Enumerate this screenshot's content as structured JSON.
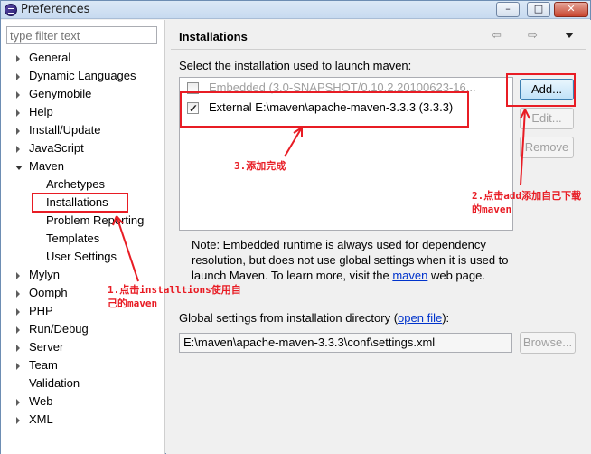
{
  "window": {
    "title": "Preferences",
    "min": "–",
    "max": "□",
    "close": "✕"
  },
  "sidebar": {
    "filter_placeholder": "type filter text",
    "items": [
      {
        "label": "General"
      },
      {
        "label": "Dynamic Languages"
      },
      {
        "label": "Genymobile"
      },
      {
        "label": "Help"
      },
      {
        "label": "Install/Update"
      },
      {
        "label": "JavaScript"
      },
      {
        "label": "Maven"
      },
      {
        "label": "Archetypes"
      },
      {
        "label": "Installations"
      },
      {
        "label": "Problem Reporting"
      },
      {
        "label": "Templates"
      },
      {
        "label": "User Settings"
      },
      {
        "label": "Mylyn"
      },
      {
        "label": "Oomph"
      },
      {
        "label": "PHP"
      },
      {
        "label": "Run/Debug"
      },
      {
        "label": "Server"
      },
      {
        "label": "Team"
      },
      {
        "label": "Validation"
      },
      {
        "label": "Web"
      },
      {
        "label": "XML"
      }
    ]
  },
  "main": {
    "title": "Installations",
    "back_icon": "⇦",
    "forward_icon": "⇨",
    "select_label": "Select the installation used to launch maven:",
    "installations": [
      {
        "label": "Embedded (3.0-SNAPSHOT/0.10.2.20100623-16...",
        "checked": false
      },
      {
        "label": "External E:\\maven\\apache-maven-3.3.3 (3.3.3)",
        "checked": true
      }
    ],
    "buttons": {
      "add": "Add...",
      "edit": "Edit...",
      "remove": "Remove"
    },
    "note_prefix": "Note: Embedded runtime is always used for dependency resolution, but does not use global settings when it is used to launch Maven. To learn more, visit the ",
    "note_link": "maven",
    "note_suffix": " web page.",
    "global_label_prefix": "Global settings from installation directory (",
    "global_link": "open file",
    "global_label_suffix": "):",
    "global_path": "E:\\maven\\apache-maven-3.3.3\\conf\\settings.xml",
    "browse": "Browse..."
  },
  "annotations": {
    "step1": "1.点击installtions使用自己的maven",
    "step2": "2.点击add添加自己下载的maven",
    "step3": "3.添加完成"
  },
  "colors": {
    "annotation": "#e81c24",
    "link": "#0033cc"
  }
}
